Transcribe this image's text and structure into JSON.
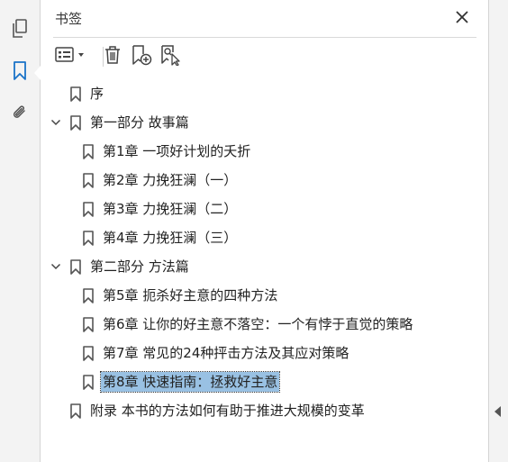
{
  "panel": {
    "title": "书签"
  },
  "rail": {
    "items": [
      {
        "icon": "pages-icon"
      },
      {
        "icon": "bookmark-icon",
        "active": true
      },
      {
        "icon": "attachment-icon"
      }
    ]
  },
  "toolbar": {
    "buttons": [
      "options-menu-icon",
      "delete-bookmark-icon",
      "new-bookmark-icon",
      "find-current-bookmark-icon"
    ]
  },
  "bookmarks": [
    {
      "label": "序",
      "level": 0,
      "expandable": false
    },
    {
      "label": "第一部分 故事篇",
      "level": 0,
      "expandable": true,
      "expanded": true
    },
    {
      "label": "第1章 一项好计划的夭折",
      "level": 1
    },
    {
      "label": "第2章 力挽狂澜（一）",
      "level": 1
    },
    {
      "label": "第3章 力挽狂澜（二）",
      "level": 1
    },
    {
      "label": "第4章 力挽狂澜（三）",
      "level": 1
    },
    {
      "label": "第二部分 方法篇",
      "level": 0,
      "expandable": true,
      "expanded": true
    },
    {
      "label": "第5章 扼杀好主意的四种方法",
      "level": 1
    },
    {
      "label": "第6章 让你的好主意不落空：一个有悖于直觉的策略",
      "level": 1
    },
    {
      "label": "第7章 常见的24种抨击方法及其应对策略",
      "level": 1
    },
    {
      "label": "第8章 快速指南：拯救好主意",
      "level": 1,
      "selected": true
    },
    {
      "label": "附录 本书的方法如何有助于推进大规模的变革",
      "level": 0,
      "expandable": false
    }
  ],
  "colors": {
    "accent": "#1a73c8",
    "selection": "#99c1e3"
  }
}
